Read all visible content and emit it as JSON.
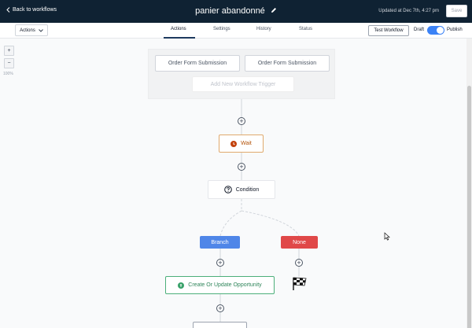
{
  "header": {
    "back_label": "Back to workflows",
    "workflow_name": "panier abandonné",
    "updated_text": "Updated at Dec 7th, 4:27 pm",
    "save_label": "Save"
  },
  "toolbar": {
    "actions_dropdown": "Actions",
    "tabs": [
      {
        "label": "Actions",
        "active": true
      },
      {
        "label": "Settings",
        "active": false
      },
      {
        "label": "History",
        "active": false
      },
      {
        "label": "Status",
        "active": false
      }
    ],
    "test_workflow_label": "Test Workflow",
    "draft_label": "Draft",
    "publish_label": "Publish",
    "published": true,
    "toggle_color": "#3b82f6"
  },
  "zoom": {
    "zoom_in": "+",
    "zoom_out": "−",
    "level": "100%"
  },
  "triggers": {
    "items": [
      "Order Form Submission",
      "Order Form Submission"
    ],
    "add_label": "Add New Workflow Trigger"
  },
  "workflow": {
    "add_symbol": "+",
    "wait_label": "Wait",
    "condition_label": "Condition",
    "branch_label": "Branch",
    "none_label": "None",
    "opportunity_label": "Create Or Update Opportunity",
    "colors": {
      "wait": "#b45309",
      "branch": "#4f86e8",
      "none": "#e04848",
      "opportunity": "#2f855a"
    }
  }
}
